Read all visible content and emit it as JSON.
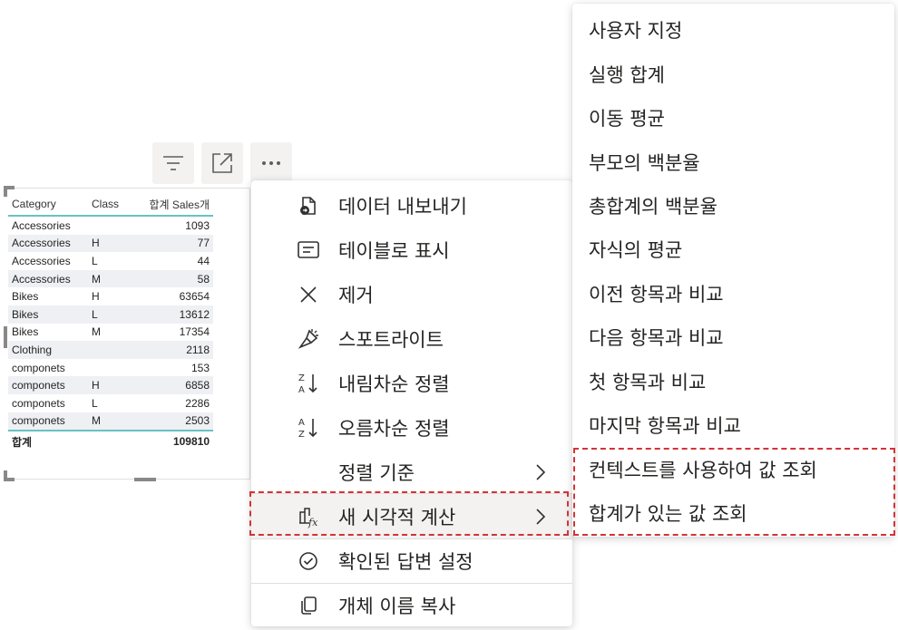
{
  "table": {
    "headers": [
      "Category",
      "Class",
      "합계 Sales개"
    ],
    "rows": [
      [
        "Accessories",
        "",
        "1093"
      ],
      [
        "Accessories",
        "H",
        "77"
      ],
      [
        "Accessories",
        "L",
        "44"
      ],
      [
        "Accessories",
        "M",
        "58"
      ],
      [
        "Bikes",
        "H",
        "63654"
      ],
      [
        "Bikes",
        "L",
        "13612"
      ],
      [
        "Bikes",
        "M",
        "17354"
      ],
      [
        "Clothing",
        "",
        "2118"
      ],
      [
        "componets",
        "",
        "153"
      ],
      [
        "componets",
        "H",
        "6858"
      ],
      [
        "componets",
        "L",
        "2286"
      ],
      [
        "componets",
        "M",
        "2503"
      ]
    ],
    "total_label": "합계",
    "total_value": "109810"
  },
  "visual_header": {
    "filter_icon": "filter-icon",
    "focus_icon": "focus-mode-icon",
    "more_icon": "more-options-icon"
  },
  "context_menu": {
    "items": [
      {
        "label": "데이터 내보내기",
        "icon": "export-data-icon"
      },
      {
        "label": "테이블로 표시",
        "icon": "show-as-table-icon"
      },
      {
        "label": "제거",
        "icon": "remove-icon"
      },
      {
        "label": "스포트라이트",
        "icon": "spotlight-icon"
      },
      {
        "label": "내림차순 정렬",
        "icon": "sort-descending-icon"
      },
      {
        "label": "오름차순 정렬",
        "icon": "sort-ascending-icon"
      },
      {
        "label": "정렬 기준",
        "icon": ""
      },
      {
        "label": "새 시각적 계산",
        "icon": "visual-calculation-icon"
      },
      {
        "label": "확인된 답변 설정",
        "icon": "verified-answer-icon"
      },
      {
        "label": "개체 이름 복사",
        "icon": "copy-icon"
      }
    ]
  },
  "submenu": {
    "items": [
      "사용자 지정",
      "실행 합계",
      "이동 평균",
      "부모의 백분율",
      "총합계의 백분율",
      "자식의 평균",
      "이전 항목과 비교",
      "다음 항목과 비교",
      "첫 항목과 비교",
      "마지막 항목과 비교",
      "컨텍스트를 사용하여 값 조회",
      "합계가 있는 값 조회"
    ]
  },
  "colors": {
    "highlight_border": "#d13438",
    "table_accent": "#6bc1c1",
    "menu_hover": "#f3f2f1"
  }
}
